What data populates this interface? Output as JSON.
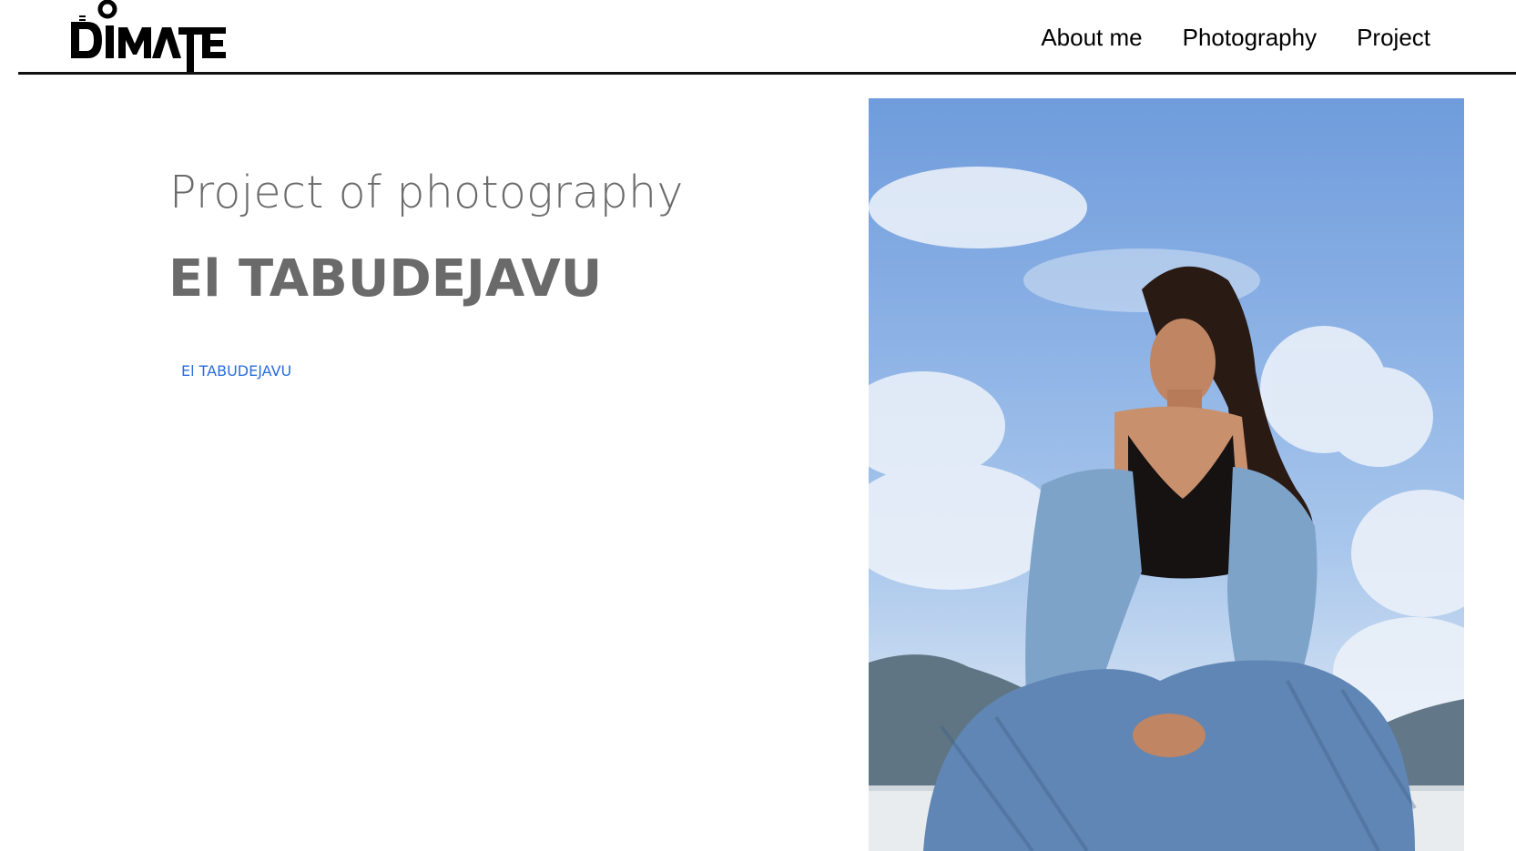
{
  "header": {
    "logo_alt": "DIMATE",
    "nav": [
      {
        "label": "About me"
      },
      {
        "label": "Photography"
      },
      {
        "label": "Project"
      }
    ]
  },
  "main": {
    "subtitle": "Project of photography",
    "title": "El TABUDEJAVU",
    "link_label": "El TABUDEJAVU"
  },
  "photo": {
    "description_icon": "portrait-photo"
  },
  "colors": {
    "link": "#2a6edb",
    "text_gray": "#6a6a6a",
    "rule": "#111111"
  }
}
